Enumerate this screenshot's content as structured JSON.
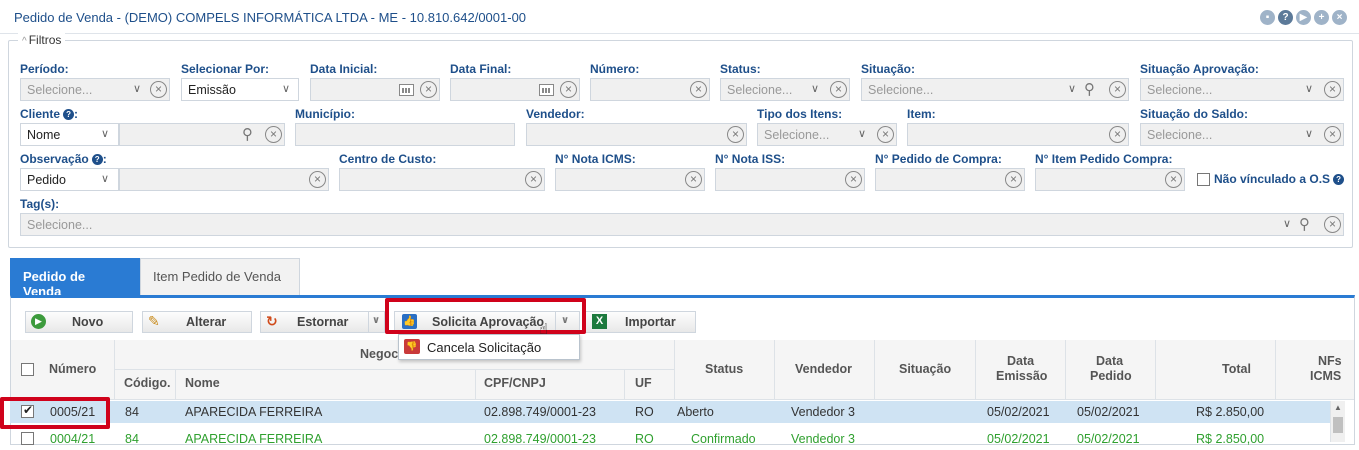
{
  "title": "Pedido de Venda - (DEMO) COMPELS INFORMÁTICA LTDA - ME - 10.810.642/0001-00",
  "filters": {
    "legend": "Filtros",
    "periodo": {
      "label": "Período:",
      "value": "Selecione..."
    },
    "selecionar_por": {
      "label": "Selecionar Por:",
      "value": "Emissão"
    },
    "data_inicial": {
      "label": "Data Inicial:"
    },
    "data_final": {
      "label": "Data Final:"
    },
    "numero": {
      "label": "Número:"
    },
    "status": {
      "label": "Status:",
      "value": "Selecione..."
    },
    "situacao": {
      "label": "Situação:",
      "value": "Selecione..."
    },
    "situacao_aprovacao": {
      "label": "Situação Aprovação:",
      "value": "Selecione..."
    },
    "cliente": {
      "label": "Cliente",
      "type_value": "Nome"
    },
    "municipio": {
      "label": "Município:"
    },
    "vendedor": {
      "label": "Vendedor:"
    },
    "tipo_itens": {
      "label": "Tipo dos Itens:",
      "value": "Selecione..."
    },
    "item": {
      "label": "Item:"
    },
    "situacao_saldo": {
      "label": "Situação do Saldo:",
      "value": "Selecione..."
    },
    "observacao": {
      "label": "Observação",
      "type_value": "Pedido"
    },
    "centro_custo": {
      "label": "Centro de Custo:"
    },
    "nota_icms": {
      "label": "N° Nota ICMS:"
    },
    "nota_iss": {
      "label": "N° Nota ISS:"
    },
    "pedido_compra": {
      "label": "N° Pedido de Compra:"
    },
    "item_pedido_compra": {
      "label": "N° Item Pedido Compra:"
    },
    "nao_vinculado": {
      "label": "Não vínculado a O.S"
    },
    "tags": {
      "label": "Tag(s):",
      "value": "Selecione..."
    }
  },
  "tabs": [
    {
      "label": "Pedido de Venda"
    },
    {
      "label": "Item Pedido de Venda"
    }
  ],
  "toolbar": {
    "novo": "Novo",
    "alterar": "Alterar",
    "estornar": "Estornar",
    "solicita_aprovacao": "Solicita Aprovação",
    "importar": "Importar",
    "menu_cancela": "Cancela Solicitação"
  },
  "grid": {
    "headers": {
      "numero": "Número",
      "negocio": "Negoc",
      "codigo": "Código.",
      "nome": "Nome",
      "cpf": "CPF/CNPJ",
      "uf": "UF",
      "status": "Status",
      "vendedor": "Vendedor",
      "situacao": "Situação",
      "data_emissao_1": "Data",
      "data_emissao_2": "Emissão",
      "data_pedido_1": "Data",
      "data_pedido_2": "Pedido",
      "total": "Total",
      "nfs_1": "NFs",
      "nfs_2": "ICMS"
    },
    "rows": [
      {
        "numero": "0005/21",
        "codigo": "84",
        "nome": "APARECIDA FERREIRA",
        "cpf": "02.898.749/0001-23",
        "uf": "RO",
        "status": "Aberto",
        "vendedor": "Vendedor 3",
        "situacao": "",
        "emissao": "05/02/2021",
        "pedido": "05/02/2021",
        "total": "R$ 2.850,00"
      },
      {
        "numero": "0004/21",
        "codigo": "84",
        "nome": "APARECIDA FERREIRA",
        "cpf": "02.898.749/0001-23",
        "uf": "RO",
        "status": "Confirmado",
        "vendedor": "Vendedor 3",
        "situacao": "",
        "emissao": "05/02/2021",
        "pedido": "05/02/2021",
        "total": "R$ 2.850,00"
      }
    ]
  },
  "colors": {
    "accent": "#2a7bd3",
    "label": "#1e4f8a",
    "highlight": "#d0021b",
    "green": "#2fa02f"
  }
}
